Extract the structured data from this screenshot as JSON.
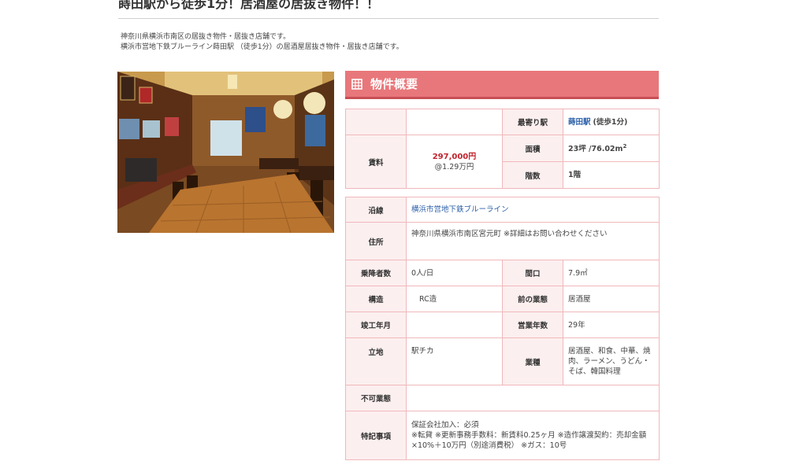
{
  "page": {
    "title": "蒔田駅から徒歩1分！居酒屋の居抜き物件！！",
    "intro_line1": "神奈川県横浜市南区の居抜き物件・居抜き店舗です。",
    "intro_line2": "横浜市営地下鉄ブルーライン蒔田駅 （徒歩1分）の居酒屋居抜き物件・居抜き店舗です。"
  },
  "section": {
    "title": "物件概要",
    "icon": "building-icon"
  },
  "summary": {
    "rent_label": "賃料",
    "rent_value": "297,000円",
    "rent_per_tsubo": "@1.29万円",
    "station_label": "最寄り駅",
    "station_name": "蒔田駅",
    "station_walk": "(徒歩1分)",
    "area_label": "面積",
    "area_value": "23坪 /76.02m",
    "area_sup": "2",
    "floor_label": "階数",
    "floor_value": "1階"
  },
  "details": {
    "line_label": "沿線",
    "line_value": "横浜市営地下鉄ブルーライン",
    "address_label": "住所",
    "address_value": "神奈川県横浜市南区宮元町 ※詳細はお問い合わせください",
    "passengers_label": "乗降者数",
    "passengers_value": "0人/日",
    "frontage_label": "間口",
    "frontage_value": "7.9㎡",
    "structure_label": "構造",
    "structure_value": "RC造",
    "prev_business_label": "前の業態",
    "prev_business_value": "居酒屋",
    "built_label": "竣工年月",
    "built_value": "",
    "years_label": "営業年数",
    "years_value": "29年",
    "location_label": "立地",
    "location_value": "駅チカ",
    "category_label": "業種",
    "category_value": "居酒屋、和食、中華、焼肉、ラーメン、うどん・そば、韓国料理",
    "prohibited_label": "不可業態",
    "prohibited_value": "",
    "notes_label": "特記事項",
    "notes_line1": "保証会社加入：必須",
    "notes_line2": "※転貸 ※更新事務手数料：新賃料0.25ヶ月 ※造作譲渡契約：売却金額",
    "notes_line3": "×10%＋10万円（別途消費税） ※ガス：10号"
  },
  "colors": {
    "header_bg": "#e8777b",
    "label_bg": "#fcefef",
    "border": "#f0b8bb",
    "price": "#c0222c",
    "link": "#2b5fa8"
  }
}
